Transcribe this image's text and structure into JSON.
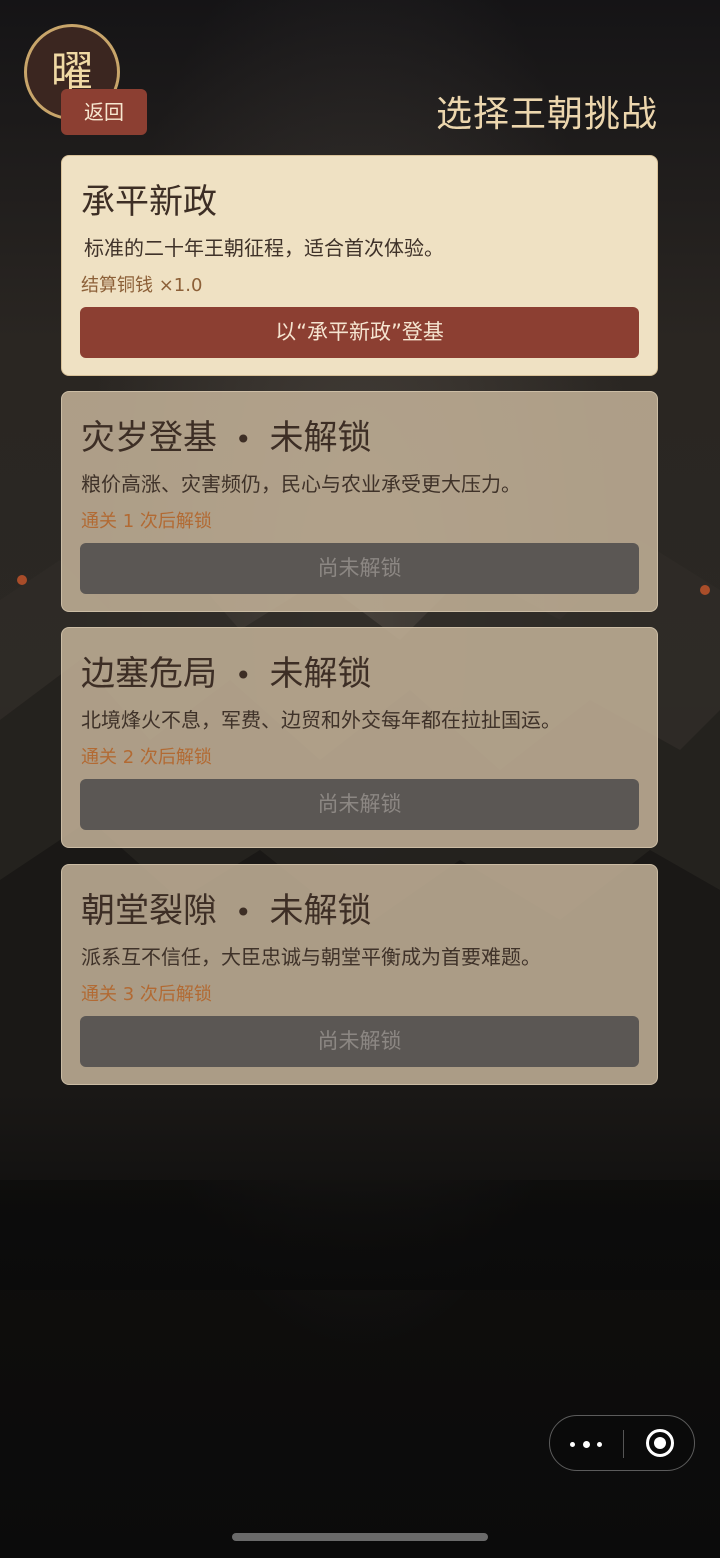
{
  "header": {
    "avatar_char": "曜",
    "back_label": "返回",
    "title": "选择王朝挑战"
  },
  "cards": [
    {
      "name": "承平新政",
      "status": "",
      "description": "标准的二十年王朝征程，适合首次体验。",
      "meta": "结算铜钱 ×1.0",
      "action": "以“承平新政”登基",
      "locked": false
    },
    {
      "name": "灾岁登基",
      "status": "未解锁",
      "description": "粮价高涨、灾害频仍，民心与农业承受更大压力。",
      "meta": "通关 1 次后解锁",
      "action": "尚未解锁",
      "locked": true
    },
    {
      "name": "边塞危局",
      "status": "未解锁",
      "description": "北境烽火不息，军费、边贸和外交每年都在拉扯国运。",
      "meta": "通关 2 次后解锁",
      "action": "尚未解锁",
      "locked": true
    },
    {
      "name": "朝堂裂隙",
      "status": "未解锁",
      "description": "派系互不信任，大臣忠诚与朝堂平衡成为首要难题。",
      "meta": "通关 3 次后解锁",
      "action": "尚未解锁",
      "locked": true
    }
  ],
  "capsule": {
    "more_icon": "more-dots-icon",
    "close_icon": "target-close-icon"
  }
}
